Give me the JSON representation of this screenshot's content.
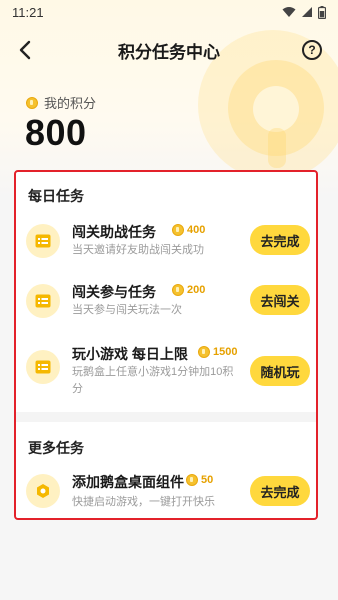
{
  "status_bar": {
    "time": "11:21"
  },
  "header": {
    "title": "积分任务中心",
    "help_symbol": "?"
  },
  "points": {
    "label": "我的积分",
    "value": "800"
  },
  "sections": [
    {
      "title": "每日任务",
      "tasks": [
        {
          "name": "闯关助战任务",
          "reward": "400",
          "desc": "当天邀请好友助战闯关成功",
          "button": "去完成",
          "icon": "list-icon"
        },
        {
          "name": "闯关参与任务",
          "reward": "200",
          "desc": "当天参与闯关玩法一次",
          "button": "去闯关",
          "icon": "list-icon"
        },
        {
          "name": "玩小游戏 每日上限",
          "reward": "1500",
          "desc": "玩鹅盒上任意小游戏1分钟加10积分",
          "button": "随机玩",
          "icon": "list-icon"
        }
      ]
    },
    {
      "title": "更多任务",
      "tasks": [
        {
          "name": "添加鹅盒桌面组件",
          "reward": "50",
          "desc": "快捷启动游戏，一键打开快乐",
          "button": "去完成",
          "icon": "hexagon-icon"
        }
      ]
    }
  ],
  "colors": {
    "accent": "#ffd83d",
    "reward": "#e6a100",
    "highlight_border": "#e3212a",
    "coin": "#f5c12e"
  }
}
